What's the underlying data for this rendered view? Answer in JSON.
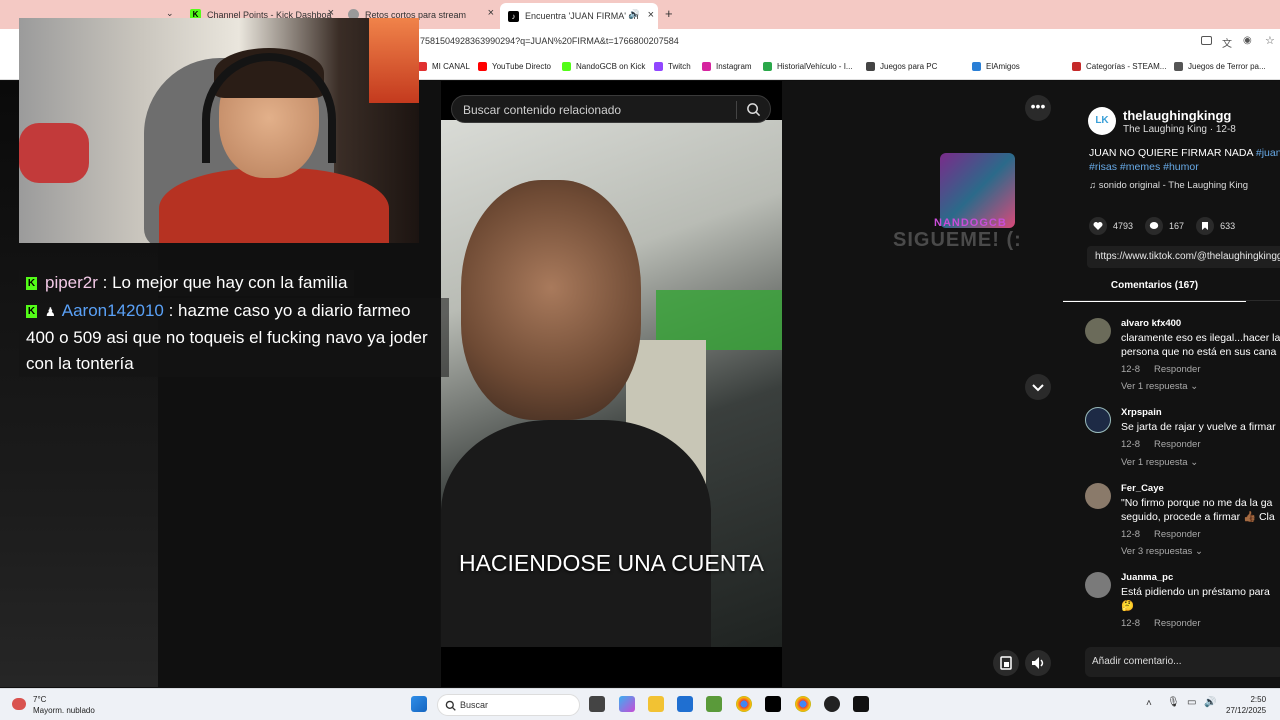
{
  "browser": {
    "tabs": [
      {
        "label": "Channel Points - Kick Dashboa",
        "favicon": "kick-icon",
        "color": "#53fc18"
      },
      {
        "label": "Retos cortos para stream",
        "favicon": "globe-icon",
        "color": "#777777"
      },
      {
        "label": "Encuentra 'JUAN FIRMA' en",
        "favicon": "tiktok-icon",
        "color": "#000000"
      }
    ],
    "new_tab": "+",
    "url": "7581504928363990294?q=JUAN%20FIRMA&t=1766800207584",
    "bookmarks": [
      {
        "label": "MI CANAL",
        "color": "#e03030"
      },
      {
        "label": "YouTube Directo",
        "color": "#ff0000"
      },
      {
        "label": "NandoGCB on Kick",
        "color": "#53fc18"
      },
      {
        "label": "Twitch",
        "color": "#9146ff"
      },
      {
        "label": "Instagram",
        "color": "#d6249f"
      },
      {
        "label": "HistorialVehículo - I...",
        "color": "#2aa84a"
      },
      {
        "label": "Juegos para PC",
        "color": "#444444"
      },
      {
        "label": "ElAmigos",
        "color": "#2a7fd6"
      },
      {
        "label": "Categorías - STEAM...",
        "color": "#c52a2a"
      },
      {
        "label": "Juegos de Terror pa...",
        "color": "#555555"
      }
    ]
  },
  "stream": {
    "chat": [
      {
        "user": "piper2r",
        "message": ": Lo mejor que hay con la familia"
      },
      {
        "user": "Aaron142010",
        "message": ": hazme caso yo a diario farmeo 400 o 509 asi que no toqueis el fucking navo ya joder con la tontería"
      }
    ],
    "overlay_name": "NANDOGCB",
    "overlay_follow": "SIGUEME! (:"
  },
  "tiktok": {
    "search_placeholder": "Buscar contenido relacionado",
    "video_caption": "HACIENDOSE UNA CUENTA",
    "author": {
      "handle": "thelaughingkingg",
      "name_date": "The Laughing King · 12-8",
      "avatar_text": "LK"
    },
    "description": {
      "text": "JUAN NO QUIERE FIRMAR NADA ",
      "tags_line1": "#juan",
      "tags_line2": "#risas #memes #humor"
    },
    "sound": "sonido original - The Laughing King",
    "stats": {
      "likes": "4793",
      "comments": "167",
      "saves": "633"
    },
    "link": "https://www.tiktok.com/@thelaughingkingg",
    "comments_tab": "Comentarios (167)",
    "comments": [
      {
        "user": "alvaro kfx400",
        "text1": "claramente eso es ilegal...hacer la",
        "text2": "persona que no está en sus cana",
        "meta": "12-8",
        "reply": "Responder",
        "replies": "Ver 1 respuesta"
      },
      {
        "user": "Xrpspain",
        "text1": "Se jarta de rajar y vuelve a firmar",
        "text2": "",
        "meta": "12-8",
        "reply": "Responder",
        "replies": "Ver 1 respuesta"
      },
      {
        "user": "Fer_Caye",
        "text1": "\"No firmo porque no me da la ga",
        "text2": "seguido, procede a firmar 👍🏾 Cla",
        "meta": "12-8",
        "reply": "Responder",
        "replies": "Ver 3 respuestas"
      },
      {
        "user": "Juanma_pc",
        "text1": "Está pidiendo un préstamo para",
        "text2": "🤔",
        "meta": "12-8",
        "reply": "Responder",
        "replies": ""
      }
    ],
    "add_comment": "Añadir comentario..."
  },
  "taskbar": {
    "weather_temp": "7°C",
    "weather_desc": "Mayorm. nublado",
    "search": "Buscar",
    "time": "2:50",
    "date": "27/12/2025"
  }
}
